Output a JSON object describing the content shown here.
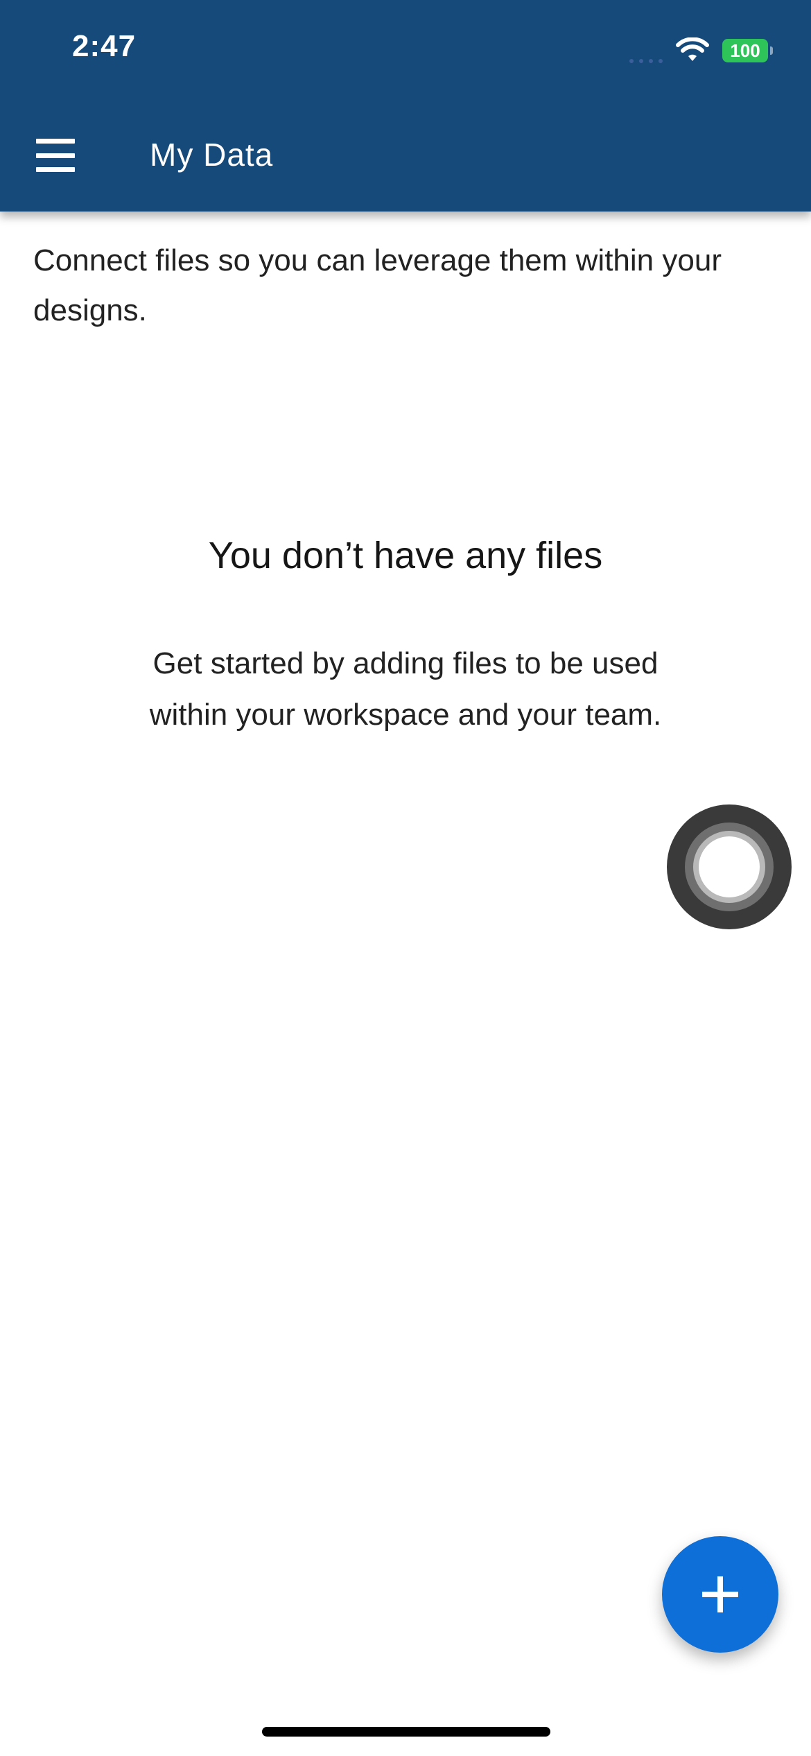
{
  "status_bar": {
    "time": "2:47",
    "battery": "100"
  },
  "app_bar": {
    "title": "My Data"
  },
  "content": {
    "intro": "Connect files so you can leverage them within your designs.",
    "empty_state": {
      "title": "You don’t have any files",
      "description": "Get started by adding files to be used within your workspace and your team."
    }
  },
  "icons": {
    "menu": "hamburger-menu-icon",
    "add": "plus-icon",
    "wifi": "wifi-icon",
    "assistive_touch": "assistive-touch-icon"
  },
  "colors": {
    "app_bar": "#154A7A",
    "fab": "#0F6FD8",
    "battery": "#2EC45A"
  }
}
